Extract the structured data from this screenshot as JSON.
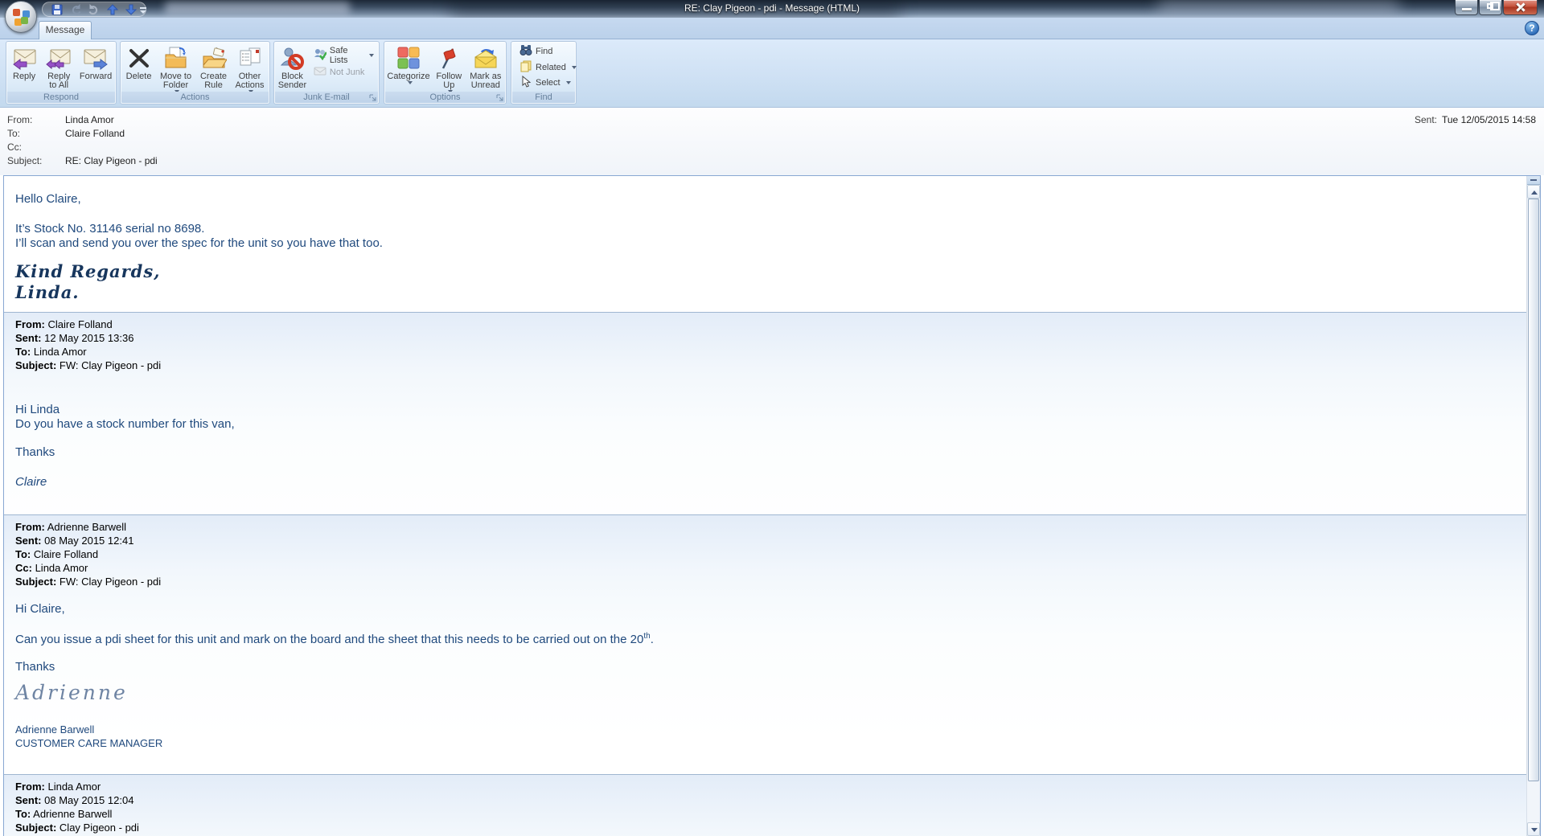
{
  "window": {
    "title": "RE: Clay Pigeon - pdi - Message (HTML)"
  },
  "ribbon": {
    "tab": "Message",
    "help_glyph": "?",
    "respond": {
      "caption": "Respond",
      "reply": "Reply",
      "reply_all": "Reply\nto All",
      "forward": "Forward"
    },
    "actions": {
      "caption": "Actions",
      "delete": "Delete",
      "move": "Move to\nFolder",
      "rule": "Create\nRule",
      "other": "Other\nActions"
    },
    "junk": {
      "caption": "Junk E-mail",
      "block": "Block\nSender",
      "safe": "Safe Lists",
      "notjunk": "Not Junk"
    },
    "options": {
      "caption": "Options",
      "categorize": "Categorize",
      "follow": "Follow\nUp",
      "unread": "Mark as\nUnread"
    },
    "find": {
      "caption": "Find",
      "find": "Find",
      "related": "Related",
      "select": "Select"
    }
  },
  "header": {
    "from_label": "From:",
    "from": "Linda Amor",
    "to_label": "To:",
    "to": "Claire Folland",
    "cc_label": "Cc:",
    "cc": "",
    "subject_label": "Subject:",
    "subject": "RE: Clay Pigeon - pdi",
    "sent_label": "Sent:",
    "sent": "Tue 12/05/2015 14:58"
  },
  "message": {
    "greeting": "Hello Claire,",
    "line1": "It’s Stock No. 31146 serial no 8698.",
    "line2": "I’ll scan and send you over the spec for the unit so you have that too.",
    "signoff": "Kind Regards,",
    "signature": "Linda."
  },
  "quote1": {
    "from_label": "From:",
    "from": "Claire Folland",
    "sent_label": "Sent:",
    "sent": "12 May 2015 13:36",
    "to_label": "To:",
    "to": "Linda Amor",
    "subject_label": "Subject:",
    "subject": "FW: Clay Pigeon - pdi",
    "p1": "Hi Linda",
    "p2": "Do you have a stock number for this van,",
    "p3": "Thanks",
    "sig": "Claire"
  },
  "quote2": {
    "from_label": "From:",
    "from": "Adrienne Barwell",
    "sent_label": "Sent:",
    "sent": "08 May 2015 12:41",
    "to_label": "To:",
    "to": "Claire Folland",
    "cc_label": "Cc:",
    "cc": "Linda Amor",
    "subject_label": "Subject:",
    "subject": "FW: Clay Pigeon - pdi",
    "p1": "Hi Claire,",
    "p2a": "Can you issue a pdi sheet for this unit and mark on the board and the sheet that this needs to be carried out on the 20",
    "p2_sup": "th",
    "p2b": ".",
    "p3": "Thanks",
    "script_sig": "Adrienne",
    "sig_name": "Adrienne Barwell",
    "sig_role": "CUSTOMER CARE MANAGER"
  },
  "quote3": {
    "from_label": "From:",
    "from": "Linda Amor",
    "sent_label": "Sent:",
    "sent": "08 May 2015 12:04",
    "to_label": "To:",
    "to": "Adrienne Barwell",
    "subject_label": "Subject:",
    "subject": "Clay Pigeon - pdi"
  },
  "colors": {
    "accent_blue": "#1f497d",
    "caption_text": "#66809c",
    "close_red": "#a83420",
    "flag_red": "#d8402c"
  }
}
